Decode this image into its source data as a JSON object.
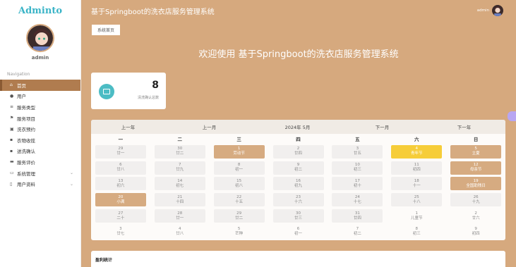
{
  "sidebar": {
    "brand": "Adminto",
    "username": "admin",
    "nav_title": "Navigation",
    "items": [
      {
        "label": "首页",
        "icon": "home-icon"
      },
      {
        "label": "用户",
        "icon": "user-icon"
      },
      {
        "label": "服务类型",
        "icon": "list-icon"
      },
      {
        "label": "服务项目",
        "icon": "flag-icon"
      },
      {
        "label": "洗衣预约",
        "icon": "calendar-icon"
      },
      {
        "label": "衣物收揽",
        "icon": "grid-icon"
      },
      {
        "label": "送洗确认",
        "icon": "grid-icon"
      },
      {
        "label": "服务评价",
        "icon": "briefcase-icon"
      },
      {
        "label": "系统管理",
        "icon": "monitor-icon"
      },
      {
        "label": "用户资料",
        "icon": "file-icon"
      }
    ]
  },
  "header": {
    "title": "基于Springboot的洗衣店服务管理系统",
    "user": "admin"
  },
  "tabs": [
    "系统首页"
  ],
  "welcome": "欢迎使用 基于Springboot的洗衣店服务管理系统",
  "stat": {
    "value": "8",
    "label": "清洗确认总数"
  },
  "calendar": {
    "prev_year": "上一年",
    "prev_month": "上一月",
    "current": "2024年 5月",
    "next_month": "下一月",
    "next_year": "下一年",
    "weekdays": [
      "一",
      "二",
      "三",
      "四",
      "五",
      "六",
      "日"
    ],
    "weeks": [
      [
        {
          "d": "29",
          "l": "廿一"
        },
        {
          "d": "30",
          "l": "廿二"
        },
        {
          "d": "1",
          "l": "劳动节",
          "hl": true
        },
        {
          "d": "2",
          "l": "廿四"
        },
        {
          "d": "3",
          "l": "廿五"
        },
        {
          "d": "4",
          "l": "青年节",
          "yl": true
        },
        {
          "d": "5",
          "l": "立夏",
          "hl": true
        }
      ],
      [
        {
          "d": "6",
          "l": "廿八"
        },
        {
          "d": "7",
          "l": "廿九"
        },
        {
          "d": "8",
          "l": "初一"
        },
        {
          "d": "9",
          "l": "初二"
        },
        {
          "d": "10",
          "l": "初三"
        },
        {
          "d": "11",
          "l": "初四"
        },
        {
          "d": "12",
          "l": "母亲节",
          "hl": true
        }
      ],
      [
        {
          "d": "13",
          "l": "初六"
        },
        {
          "d": "14",
          "l": "初七"
        },
        {
          "d": "15",
          "l": "初八"
        },
        {
          "d": "16",
          "l": "初九"
        },
        {
          "d": "17",
          "l": "初十"
        },
        {
          "d": "18",
          "l": "十一"
        },
        {
          "d": "19",
          "l": "全国助残日",
          "hl": true
        }
      ],
      [
        {
          "d": "20",
          "l": "小满",
          "hl": true
        },
        {
          "d": "21",
          "l": "十四"
        },
        {
          "d": "22",
          "l": "十五"
        },
        {
          "d": "23",
          "l": "十六"
        },
        {
          "d": "24",
          "l": "十七"
        },
        {
          "d": "25",
          "l": "十八"
        },
        {
          "d": "26",
          "l": "十九"
        }
      ],
      [
        {
          "d": "27",
          "l": "二十"
        },
        {
          "d": "28",
          "l": "廿一"
        },
        {
          "d": "29",
          "l": "廿二"
        },
        {
          "d": "30",
          "l": "廿三"
        },
        {
          "d": "31",
          "l": "廿四"
        },
        {
          "d": "1",
          "l": "儿童节",
          "plain": true
        },
        {
          "d": "2",
          "l": "廿六",
          "plain": true
        }
      ],
      [
        {
          "d": "3",
          "l": "廿七",
          "plain": true
        },
        {
          "d": "4",
          "l": "廿八",
          "plain": true
        },
        {
          "d": "5",
          "l": "芒种",
          "plain": true
        },
        {
          "d": "6",
          "l": "初一",
          "plain": true
        },
        {
          "d": "7",
          "l": "初二",
          "plain": true
        },
        {
          "d": "8",
          "l": "初三",
          "plain": true
        },
        {
          "d": "9",
          "l": "初四",
          "plain": true
        }
      ]
    ]
  },
  "profit": {
    "title": "盈利统计"
  }
}
